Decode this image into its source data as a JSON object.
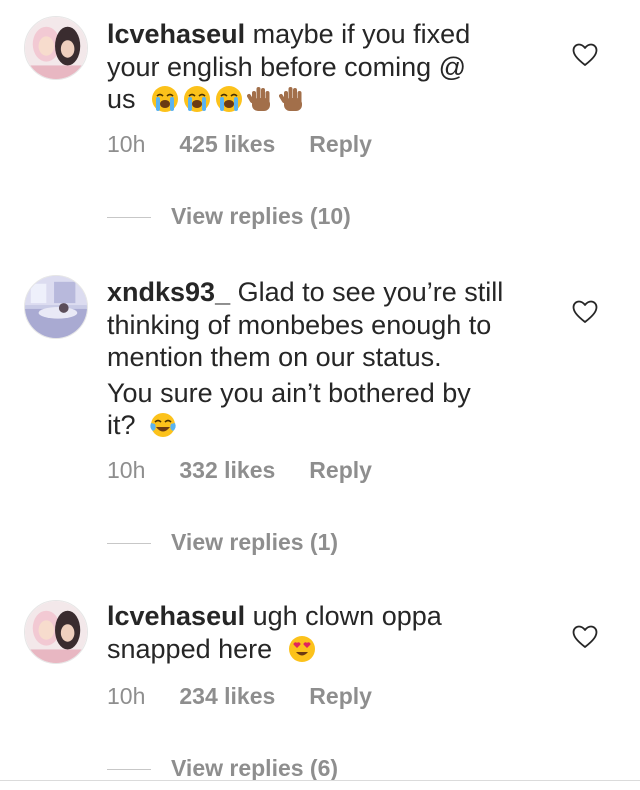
{
  "comments": [
    {
      "avatar_icon": "avatar-photo-two-girls",
      "username": "lcvehaseul",
      "text_line1": "maybe if you fixed",
      "text_line2": "your english before coming @",
      "text_line3": "us",
      "emojis": [
        "loudly-crying-face",
        "loudly-crying-face",
        "loudly-crying-face",
        "raised-hand-medium-dark",
        "raised-hand-medium-dark"
      ],
      "time": "10h",
      "likes": "425 likes",
      "reply": "Reply",
      "view_replies": "View replies (10)"
    },
    {
      "avatar_icon": "avatar-photo-bedroom",
      "username": "xndks93_",
      "text_line1": "Glad to see you’re still",
      "text_line2": "thinking of monbebes enough to",
      "text_line3": "mention them on our status.",
      "text_line4": "You sure you ain’t bothered by",
      "text_line5": "it?",
      "emojis": [
        "face-with-tears-of-joy"
      ],
      "time": "10h",
      "likes": "332 likes",
      "reply": "Reply",
      "view_replies": "View replies (1)"
    },
    {
      "avatar_icon": "avatar-photo-two-girls",
      "username": "lcvehaseul",
      "text_line1": "ugh clown oppa",
      "text_line2": "snapped here",
      "emojis": [
        "smiling-face-with-heart-eyes"
      ],
      "time": "10h",
      "likes": "234 likes",
      "reply": "Reply",
      "view_replies": "View replies (6)"
    }
  ],
  "colors": {
    "text": "#262626",
    "meta": "#8e8e8e",
    "divider": "#c7c7c7"
  }
}
